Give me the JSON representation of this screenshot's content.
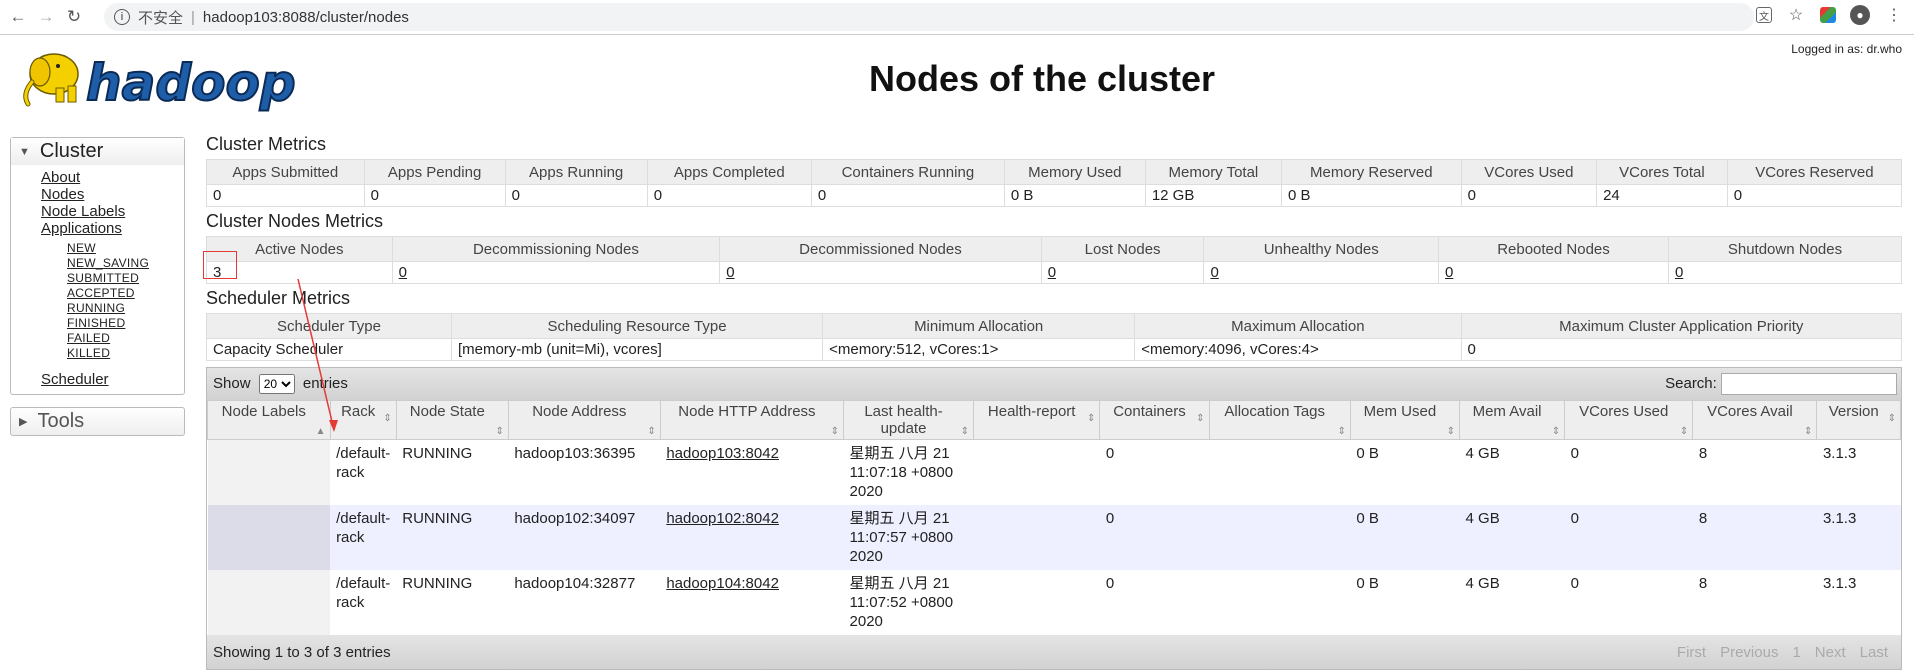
{
  "browser": {
    "insecure_label": "不安全",
    "url": "hadoop103:8088/cluster/nodes"
  },
  "header": {
    "logo_text": "hadoop",
    "title": "Nodes of the cluster",
    "logged_in": "Logged in as: dr.who"
  },
  "sidebar": {
    "cluster_label": "Cluster",
    "links": [
      "About",
      "Nodes",
      "Node Labels",
      "Applications"
    ],
    "app_states": [
      "NEW",
      "NEW_SAVING",
      "SUBMITTED",
      "ACCEPTED",
      "RUNNING",
      "FINISHED",
      "FAILED",
      "KILLED"
    ],
    "scheduler": "Scheduler",
    "tools_label": "Tools"
  },
  "cluster_metrics": {
    "title": "Cluster Metrics",
    "headers": [
      "Apps Submitted",
      "Apps Pending",
      "Apps Running",
      "Apps Completed",
      "Containers Running",
      "Memory Used",
      "Memory Total",
      "Memory Reserved",
      "VCores Used",
      "VCores Total",
      "VCores Reserved"
    ],
    "values": [
      "0",
      "0",
      "0",
      "0",
      "0",
      "0 B",
      "12 GB",
      "0 B",
      "0",
      "24",
      "0"
    ]
  },
  "nodes_metrics": {
    "title": "Cluster Nodes Metrics",
    "headers": [
      "Active Nodes",
      "Decommissioning Nodes",
      "Decommissioned Nodes",
      "Lost Nodes",
      "Unhealthy Nodes",
      "Rebooted Nodes",
      "Shutdown Nodes"
    ],
    "values": [
      "3",
      "0",
      "0",
      "0",
      "0",
      "0",
      "0"
    ]
  },
  "scheduler_metrics": {
    "title": "Scheduler Metrics",
    "headers": [
      "Scheduler Type",
      "Scheduling Resource Type",
      "Minimum Allocation",
      "Maximum Allocation",
      "Maximum Cluster Application Priority"
    ],
    "values": [
      "Capacity Scheduler",
      "[memory-mb (unit=Mi), vcores]",
      "<memory:512, vCores:1>",
      "<memory:4096, vCores:4>",
      "0"
    ]
  },
  "nodes_table": {
    "show_label": "Show",
    "page_size": "20",
    "entries_label": "entries",
    "search_label": "Search:",
    "headers": [
      "Node Labels",
      "Rack",
      "Node State",
      "Node Address",
      "Node HTTP Address",
      "Last health-update",
      "Health-report",
      "Containers",
      "Allocation Tags",
      "Mem Used",
      "Mem Avail",
      "VCores Used",
      "VCores Avail",
      "Version"
    ],
    "rows": [
      [
        "",
        "/default-rack",
        "RUNNING",
        "hadoop103:36395",
        "hadoop103:8042",
        "星期五 八月 21 11:07:18 +0800 2020",
        "",
        "0",
        "",
        "0 B",
        "4 GB",
        "0",
        "8",
        "3.1.3"
      ],
      [
        "",
        "/default-rack",
        "RUNNING",
        "hadoop102:34097",
        "hadoop102:8042",
        "星期五 八月 21 11:07:57 +0800 2020",
        "",
        "0",
        "",
        "0 B",
        "4 GB",
        "0",
        "8",
        "3.1.3"
      ],
      [
        "",
        "/default-rack",
        "RUNNING",
        "hadoop104:32877",
        "hadoop104:8042",
        "星期五 八月 21 11:07:52 +0800 2020",
        "",
        "0",
        "",
        "0 B",
        "4 GB",
        "0",
        "8",
        "3.1.3"
      ]
    ],
    "info": "Showing 1 to 3 of 3 entries",
    "pager": [
      "First",
      "Previous",
      "1",
      "Next",
      "Last"
    ]
  }
}
